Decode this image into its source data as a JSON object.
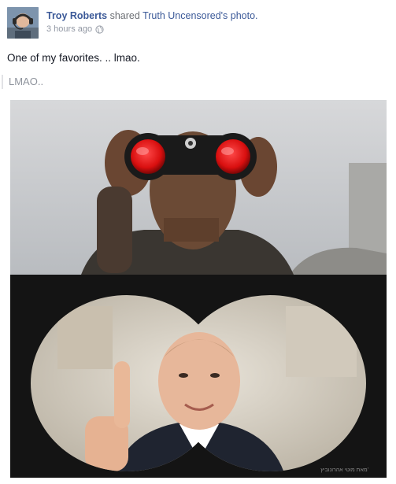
{
  "post": {
    "author": "Troy Roberts",
    "verb": "shared",
    "shared_page": "Truth Uncensored",
    "shared_suffix": "'s photo.",
    "timestamp": "3 hours ago",
    "privacy_icon": "globe-icon",
    "message": "One of my favorites. .. lmao.",
    "quoted_text": "LMAO.."
  },
  "colors": {
    "link": "#3b5998",
    "meta_text": "#9197a3",
    "binocular_lens": "#e41e1e"
  }
}
